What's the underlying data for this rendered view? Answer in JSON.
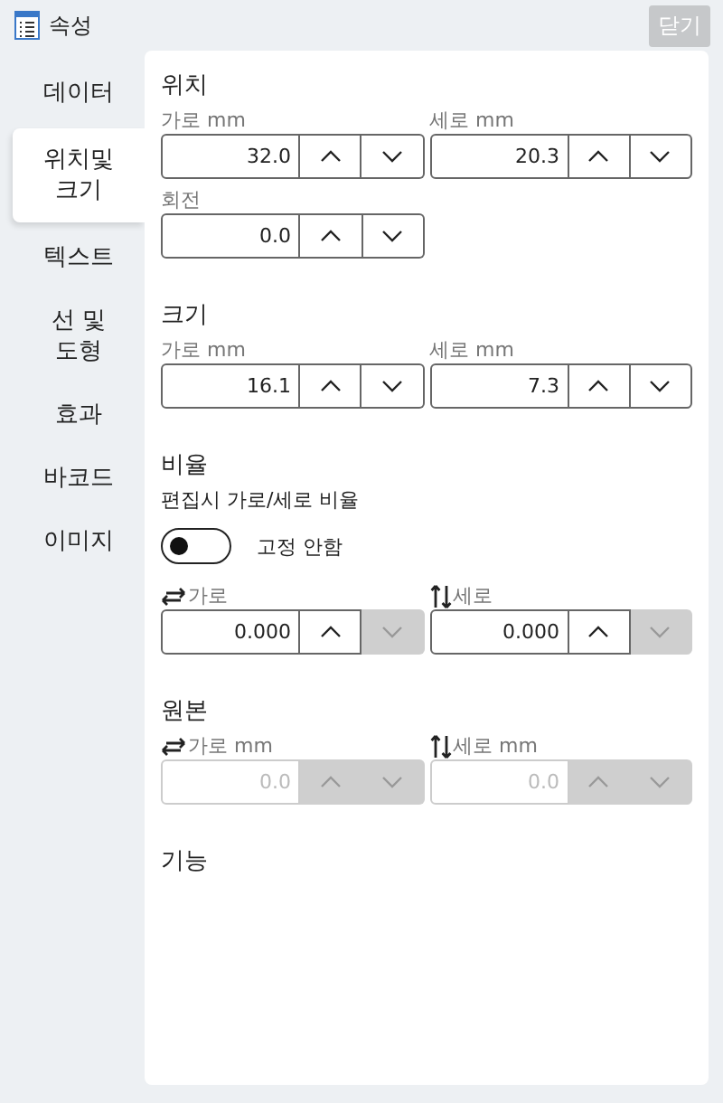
{
  "header": {
    "title": "속성",
    "close_button": "닫기",
    "close_disabled": true
  },
  "sidebar": {
    "items": [
      {
        "label": "데이터",
        "selected": false
      },
      {
        "label": "위치및\n크기",
        "selected": true
      },
      {
        "label": "텍스트",
        "selected": false
      },
      {
        "label": "선 및\n도형",
        "selected": false
      },
      {
        "label": "효과",
        "selected": false
      },
      {
        "label": "바코드",
        "selected": false
      },
      {
        "label": "이미지",
        "selected": false
      }
    ]
  },
  "sections": [
    {
      "title": "위치",
      "rows": [
        [
          {
            "label": "가로 mm",
            "value": "32.0",
            "disabled": false,
            "up_disabled": false,
            "down_disabled": false
          },
          {
            "label": "세로 mm",
            "value": "20.3",
            "disabled": false,
            "up_disabled": false,
            "down_disabled": false
          }
        ],
        [
          {
            "label": "회전",
            "value": "0.0",
            "disabled": false,
            "up_disabled": false,
            "down_disabled": false
          }
        ]
      ]
    },
    {
      "title": "크기",
      "rows": [
        [
          {
            "label": "가로 mm",
            "value": "16.1",
            "disabled": false,
            "up_disabled": false,
            "down_disabled": false
          },
          {
            "label": "세로 mm",
            "value": "7.3",
            "disabled": false,
            "up_disabled": false,
            "down_disabled": false
          }
        ]
      ]
    },
    {
      "title": "비율",
      "subtitle": "편집시 가로/세로 비율",
      "toggle": {
        "label": "고정 안함",
        "on": false
      },
      "rows": [
        [
          {
            "label": "가로",
            "kind": "horizontal",
            "value": "0.000",
            "disabled": false,
            "up_disabled": false,
            "down_disabled": true
          },
          {
            "label": "세로",
            "kind": "vertical",
            "value": "0.000",
            "disabled": false,
            "up_disabled": false,
            "down_disabled": true
          }
        ]
      ]
    },
    {
      "title": "원본",
      "rows": [
        [
          {
            "label": "가로 mm",
            "kind": "horizontal",
            "value": "0.0",
            "disabled": true,
            "up_disabled": true,
            "down_disabled": true
          },
          {
            "label": "세로 mm",
            "kind": "vertical",
            "value": "0.0",
            "disabled": true,
            "up_disabled": true,
            "down_disabled": true
          }
        ]
      ]
    },
    {
      "title": "기능"
    }
  ]
}
